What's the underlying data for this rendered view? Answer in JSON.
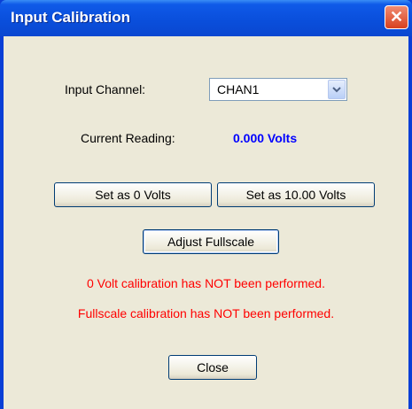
{
  "window": {
    "title": "Input Calibration",
    "close_glyph": "✕"
  },
  "input_channel": {
    "label": "Input Channel:",
    "selected": "CHAN1"
  },
  "current_reading": {
    "label": "Current Reading:",
    "value": "0.000 Volts"
  },
  "buttons": {
    "set_zero": "Set as 0 Volts",
    "set_full": "Set as 10.00 Volts",
    "adjust_fullscale": "Adjust Fullscale",
    "close": "Close"
  },
  "messages": {
    "zero_status": "0 Volt calibration has NOT been performed.",
    "fullscale_status": "Fullscale calibration has NOT been performed."
  },
  "colors": {
    "reading": "#0000ff",
    "warning": "#ff0000",
    "titlebar": "#0a4fdc",
    "dialog_face": "#ece9d8"
  },
  "icons": {
    "close": "close-icon",
    "dropdown": "chevron-down-icon"
  }
}
